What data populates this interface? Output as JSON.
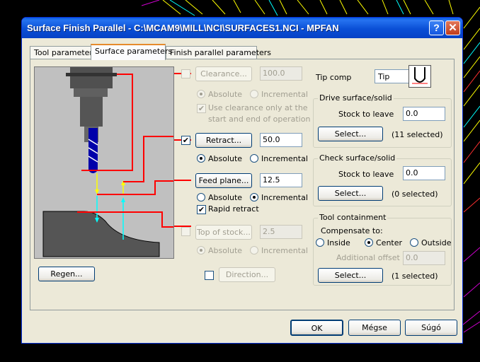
{
  "window": {
    "title": "Surface Finish Parallel - C:\\MCAM9\\MILL\\NCI\\SURFACES1.NCI - MPFAN",
    "help_label": "?",
    "close_label": "✕"
  },
  "tabs": [
    {
      "label": "Tool parameters"
    },
    {
      "label": "Surface parameters"
    },
    {
      "label": "Finish parallel parameters"
    }
  ],
  "clearance": {
    "button": "Clearance...",
    "value": "100.0",
    "checked": false,
    "absolute": "Absolute",
    "incremental": "Incremental",
    "use_only_line1": "Use clearance only at the",
    "use_only_line2": "start and end of operation"
  },
  "retract": {
    "button": "Retract...",
    "value": "50.0",
    "checked": true,
    "absolute": "Absolute",
    "incremental": "Incremental"
  },
  "feed_plane": {
    "button": "Feed plane...",
    "value": "12.5",
    "absolute": "Absolute",
    "incremental": "Incremental",
    "rapid_retract": "Rapid retract"
  },
  "top_of_stock": {
    "button": "Top of stock...",
    "value": "2.5",
    "absolute": "Absolute",
    "incremental": "Incremental"
  },
  "direction": {
    "button": "Direction..."
  },
  "regen": {
    "button": "Regen..."
  },
  "tip_comp": {
    "label": "Tip comp",
    "value": "Tip"
  },
  "drive_surface": {
    "title": "Drive surface/solid",
    "stock_label": "Stock to leave",
    "stock_value": "0.0",
    "select_button": "Select...",
    "selected_text": "(11  selected)"
  },
  "check_surface": {
    "title": "Check surface/solid",
    "stock_label": "Stock to leave",
    "stock_value": "0.0",
    "select_button": "Select...",
    "selected_text": "(0  selected)"
  },
  "tool_containment": {
    "title": "Tool containment",
    "compensate_label": "Compensate to:",
    "inside": "Inside",
    "center": "Center",
    "outside": "Outside",
    "offset_label": "Additional offset",
    "offset_value": "0.0",
    "select_button": "Select...",
    "selected_text": "(1  selected)"
  },
  "footer": {
    "ok": "OK",
    "cancel": "Mégse",
    "help": "Súgó"
  },
  "colors": {
    "title_bar": "#0a4fd6",
    "marker_lines": "#ff0000",
    "arrow_yellow": "#ffff00",
    "arrow_cyan": "#00ffff",
    "tool_body": "#0000aa"
  }
}
